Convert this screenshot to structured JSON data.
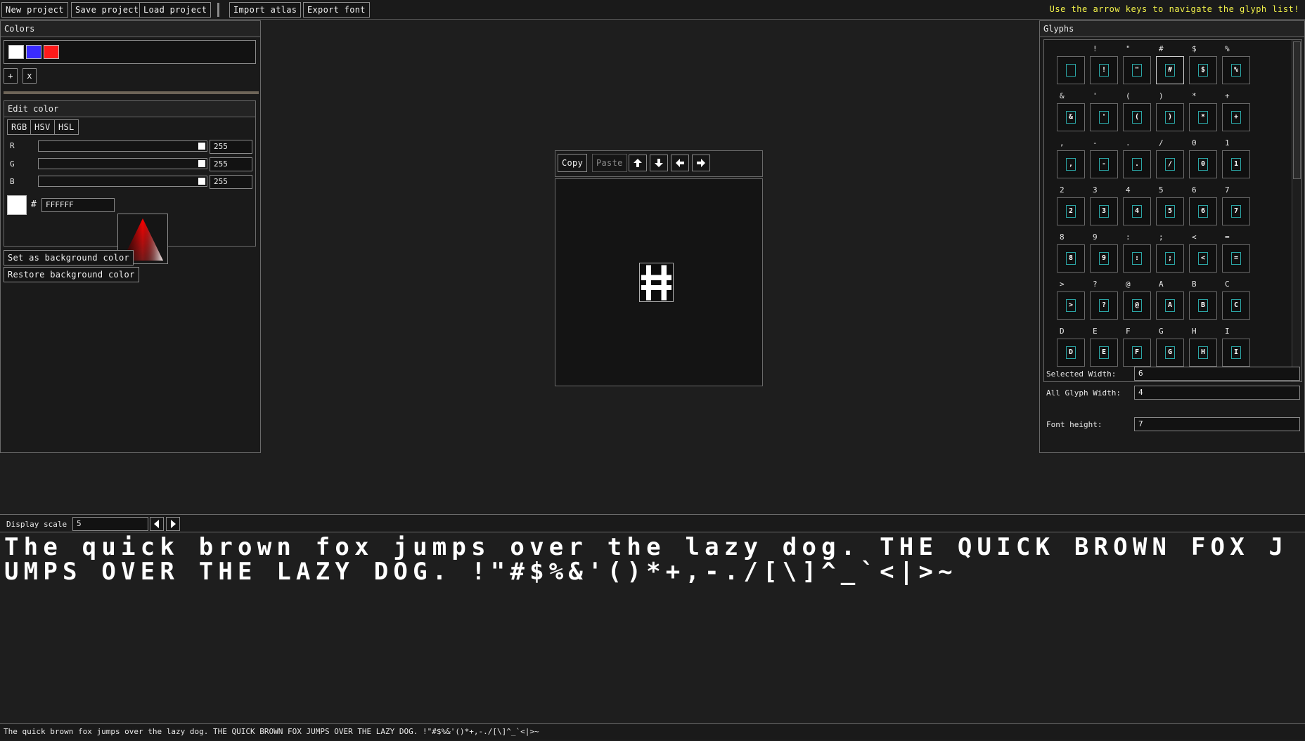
{
  "toolbar": {
    "new_project": "New project",
    "save_project": "Save project",
    "load_project": "Load project",
    "import_atlas": "Import atlas",
    "export_font": "Export font",
    "hint": "Use the arrow keys to navigate the glyph list!"
  },
  "colors_panel": {
    "title": "Colors",
    "swatches": [
      "#ffffff",
      "#3a2bff",
      "#ff1a1a"
    ],
    "add_label": "+",
    "remove_label": "x",
    "edit_title": "Edit color",
    "modes": [
      "RGB",
      "HSV",
      "HSL"
    ],
    "channels": [
      {
        "label": "R",
        "value": "255"
      },
      {
        "label": "G",
        "value": "255"
      },
      {
        "label": "B",
        "value": "255"
      }
    ],
    "hash": "#",
    "hex_value": "FFFFFF",
    "set_bg": "Set as background color",
    "restore_bg": "Restore background color"
  },
  "editor": {
    "copy": "Copy",
    "paste": "Paste",
    "arrows": [
      "up-arrow-icon",
      "down-arrow-icon",
      "left-arrow-icon",
      "right-arrow-icon"
    ]
  },
  "glyphs_panel": {
    "title": "Glyphs",
    "rows": [
      [
        " ",
        "!",
        "\"",
        "#",
        "$",
        "%"
      ],
      [
        "&",
        "'",
        "(",
        ")",
        "*",
        "+"
      ],
      [
        ",",
        "-",
        ".",
        "/",
        "0",
        "1"
      ],
      [
        "2",
        "3",
        "4",
        "5",
        "6",
        "7"
      ],
      [
        "8",
        "9",
        ":",
        ";",
        "<",
        "="
      ],
      [
        ">",
        "?",
        "@",
        "A",
        "B",
        "C"
      ],
      [
        "D",
        "E",
        "F",
        "G",
        "H",
        "I"
      ]
    ],
    "selected": "#",
    "selected_width_label": "Selected Width:",
    "selected_width": "6",
    "all_width_label": "All Glyph Width:",
    "all_width": "4",
    "font_height_label": "Font height:",
    "font_height": "7"
  },
  "display": {
    "scale_label": "Display scale",
    "scale_value": "5",
    "preview_line": "The quick brown fox jumps over the lazy dog. THE QUICK BROWN FOX JUMPS OVER THE LAZY DOG. !\"#$%&'()*+,-./[\\]^_`<|>~",
    "status_line": "The quick brown fox jumps over the lazy dog. THE QUICK BROWN FOX JUMPS OVER THE LAZY DOG. !\"#$%&'()*+,-./[\\]^_`<|>~"
  }
}
